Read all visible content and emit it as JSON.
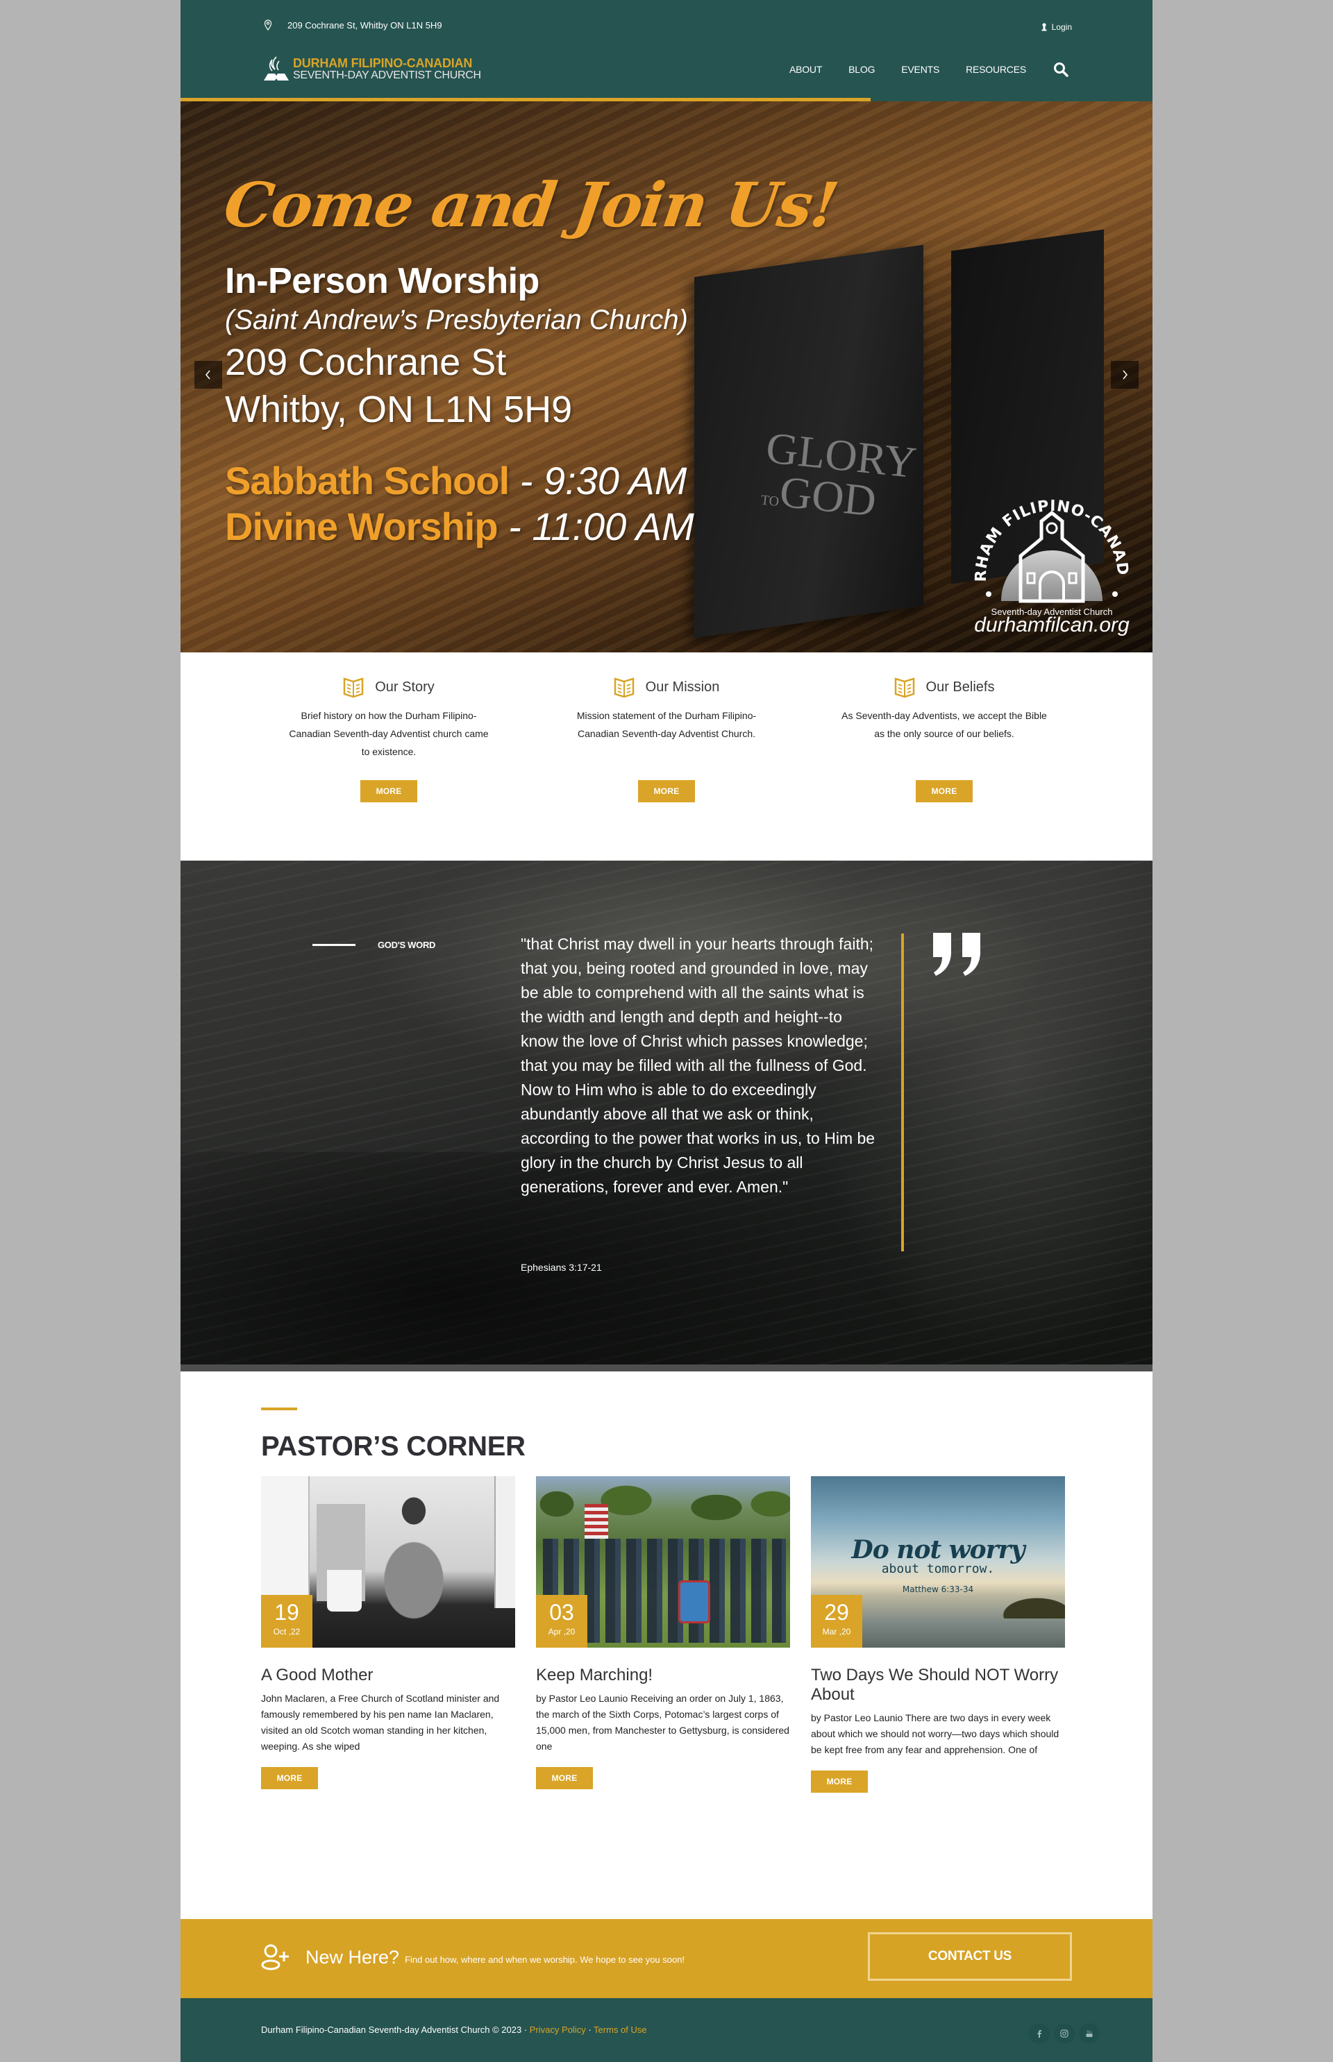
{
  "header": {
    "address": "209 Cochrane St, Whitby ON L1N 5H9",
    "login_label": "Login",
    "logo": {
      "line1": "DURHAM FILIPINO-CANADIAN",
      "line2": "SEVENTH-DAY ADVENTIST CHURCH"
    },
    "nav": [
      {
        "label": "ABOUT"
      },
      {
        "label": "BLOG"
      },
      {
        "label": "EVENTS"
      },
      {
        "label": "RESOURCES"
      }
    ],
    "search_icon": "search-icon",
    "slider_progress_percent": 71
  },
  "hero": {
    "tagline": "Come and Join Us!",
    "title": "In-Person Worship",
    "venue": "(Saint Andrew’s Presbyterian Church)",
    "address_line1": "209 Cochrane St",
    "address_line2": "Whitby, ON L1N 5H9",
    "schedule": [
      {
        "label": "Sabbath School",
        "time": " - 9:30 AM"
      },
      {
        "label": "Divine Worship",
        "time": " - 11:00 AM"
      }
    ],
    "book_text_1": "GLORY",
    "book_text_2": "TO",
    "book_text_3": "GOD",
    "badge": {
      "ring_text": "DURHAM FILIPINO-CANADIAN",
      "subtitle": "Seventh-day Adventist Church",
      "url": "durhamfilcan.org"
    },
    "prev_icon": "chevron-left-icon",
    "next_icon": "chevron-right-icon"
  },
  "features": [
    {
      "icon": "open-book-icon",
      "title": "Our Story",
      "description": "Brief history on how the Durham Filipino-Canadian Seventh-day Adventist church came to existence.",
      "button": "MORE"
    },
    {
      "icon": "open-book-icon",
      "title": "Our Mission",
      "description": "Mission statement of the Durham Filipino-Canadian Seventh-day Adventist Church.",
      "button": "MORE"
    },
    {
      "icon": "open-book-icon",
      "title": "Our Beliefs",
      "description": "As Seventh-day Adventists, we accept the Bible as the only source of our beliefs.",
      "button": "MORE"
    }
  ],
  "gods_word": {
    "label": "GOD'S WORD",
    "quote": "\"that Christ may dwell in your hearts through faith; that you, being rooted and grounded in love, may be able to comprehend with all the saints what is the width and length and depth and height--to know the love of Christ which passes knowledge; that you may be filled with all the fullness of God. Now to Him who is able to do exceedingly abundantly above all that we ask or think, according to the power that works in us, to Him be glory in the church by Christ Jesus to all generations, forever and ever. Amen.\"",
    "reference": "Ephesians 3:17-21",
    "quote_icon": "quote-mark-icon"
  },
  "pastors_corner": {
    "title": "PASTOR’S CORNER",
    "posts": [
      {
        "day": "19",
        "month_year": "Oct ,22",
        "title": "A Good Mother",
        "excerpt": "John Maclaren, a Free Church of Scotland minister and famously remembered by his pen name Ian Maclaren, visited an old Scotch woman standing in her kitchen, weeping. As she wiped",
        "button": "MORE"
      },
      {
        "day": "03",
        "month_year": "Apr ,20",
        "title": "Keep Marching!",
        "excerpt": "by Pastor Leo Launio Receiving an order on July 1, 1863, the march of the Sixth Corps, Potomac’s largest corps of 15,000 men, from Manchester to Gettysburg, is considered one",
        "button": "MORE"
      },
      {
        "day": "29",
        "month_year": "Mar ,20",
        "title": "Two Days We Should NOT Worry About",
        "excerpt": "by Pastor Leo Launio There are two days in every week about which we should not worry—two days which should be kept free from any fear and apprehension. One of",
        "button": "MORE",
        "image_caption": {
          "line1": "Do not worry",
          "line2": "about tomorrow.",
          "line3": "Matthew 6:33-34"
        }
      }
    ]
  },
  "cta": {
    "icon": "add-user-icon",
    "title": "New Here?",
    "subtitle": "Find out how, where and when we worship. We hope to see you soon!",
    "button": "CONTACT US"
  },
  "footer": {
    "copyright": "Durham Filipino-Canadian Seventh-day Adventist Church © 2023 · ",
    "privacy": "Privacy Policy",
    "separator": " · ",
    "terms": "Terms of Use",
    "social": [
      "facebook-icon",
      "instagram-icon",
      "youtube-icon"
    ]
  },
  "colors": {
    "primary_teal": "#265451",
    "accent_gold": "#d9a427",
    "cta_gold": "#d7a325",
    "hero_orange": "#f0a02a"
  }
}
